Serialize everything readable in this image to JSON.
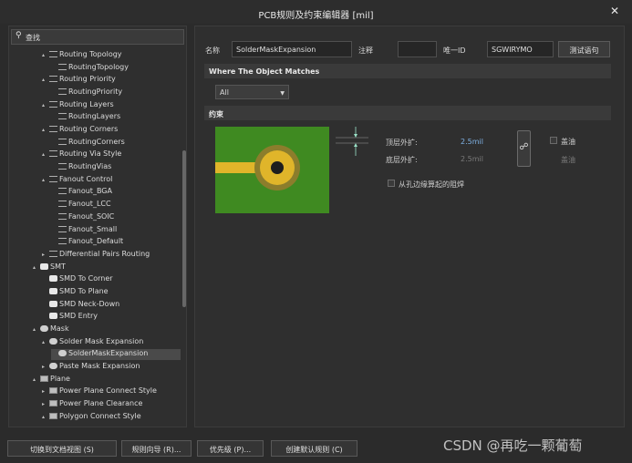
{
  "window": {
    "title": "PCB规则及约束编辑器 [mil]",
    "close_glyph": "✕"
  },
  "search": {
    "icon": "search-icon",
    "label": "查找"
  },
  "tree": [
    {
      "label": "Routing Topology",
      "indent": 3,
      "arrow": "▴",
      "icon": "route",
      "selected": false
    },
    {
      "label": "RoutingTopology",
      "indent": 4,
      "arrow": "",
      "icon": "route",
      "selected": false
    },
    {
      "label": "Routing Priority",
      "indent": 3,
      "arrow": "▴",
      "icon": "route",
      "selected": false
    },
    {
      "label": "RoutingPriority",
      "indent": 4,
      "arrow": "",
      "icon": "route",
      "selected": false
    },
    {
      "label": "Routing Layers",
      "indent": 3,
      "arrow": "▴",
      "icon": "route",
      "selected": false
    },
    {
      "label": "RoutingLayers",
      "indent": 4,
      "arrow": "",
      "icon": "route",
      "selected": false
    },
    {
      "label": "Routing Corners",
      "indent": 3,
      "arrow": "▴",
      "icon": "route",
      "selected": false
    },
    {
      "label": "RoutingCorners",
      "indent": 4,
      "arrow": "",
      "icon": "route",
      "selected": false
    },
    {
      "label": "Routing Via Style",
      "indent": 3,
      "arrow": "▴",
      "icon": "route",
      "selected": false
    },
    {
      "label": "RoutingVias",
      "indent": 4,
      "arrow": "",
      "icon": "route",
      "selected": false
    },
    {
      "label": "Fanout Control",
      "indent": 3,
      "arrow": "▴",
      "icon": "route",
      "selected": false
    },
    {
      "label": "Fanout_BGA",
      "indent": 4,
      "arrow": "",
      "icon": "route",
      "selected": false
    },
    {
      "label": "Fanout_LCC",
      "indent": 4,
      "arrow": "",
      "icon": "route",
      "selected": false
    },
    {
      "label": "Fanout_SOIC",
      "indent": 4,
      "arrow": "",
      "icon": "route",
      "selected": false
    },
    {
      "label": "Fanout_Small",
      "indent": 4,
      "arrow": "",
      "icon": "route",
      "selected": false
    },
    {
      "label": "Fanout_Default",
      "indent": 4,
      "arrow": "",
      "icon": "route",
      "selected": false
    },
    {
      "label": "Differential Pairs Routing",
      "indent": 3,
      "arrow": "▸",
      "icon": "route",
      "selected": false
    },
    {
      "label": "SMT",
      "indent": 2,
      "arrow": "▴",
      "icon": "smt",
      "selected": false
    },
    {
      "label": "SMD To Corner",
      "indent": 3,
      "arrow": "",
      "icon": "smt",
      "selected": false
    },
    {
      "label": "SMD To Plane",
      "indent": 3,
      "arrow": "",
      "icon": "smt",
      "selected": false
    },
    {
      "label": "SMD Neck-Down",
      "indent": 3,
      "arrow": "",
      "icon": "smt",
      "selected": false
    },
    {
      "label": "SMD Entry",
      "indent": 3,
      "arrow": "",
      "icon": "smt",
      "selected": false
    },
    {
      "label": "Mask",
      "indent": 2,
      "arrow": "▴",
      "icon": "mask",
      "selected": false
    },
    {
      "label": "Solder Mask Expansion",
      "indent": 3,
      "arrow": "▴",
      "icon": "mask",
      "selected": false
    },
    {
      "label": "SolderMaskExpansion",
      "indent": 4,
      "arrow": "",
      "icon": "mask",
      "selected": true
    },
    {
      "label": "Paste Mask Expansion",
      "indent": 3,
      "arrow": "▸",
      "icon": "mask",
      "selected": false
    },
    {
      "label": "Plane",
      "indent": 2,
      "arrow": "▴",
      "icon": "plane",
      "selected": false
    },
    {
      "label": "Power Plane Connect Style",
      "indent": 3,
      "arrow": "▸",
      "icon": "plane",
      "selected": false
    },
    {
      "label": "Power Plane Clearance",
      "indent": 3,
      "arrow": "▸",
      "icon": "plane",
      "selected": false
    },
    {
      "label": "Polygon Connect Style",
      "indent": 3,
      "arrow": "▴",
      "icon": "plane",
      "selected": false
    }
  ],
  "rule": {
    "name_label": "名称",
    "name_value": "SolderMaskExpansion",
    "comment_label": "注释",
    "comment_value": "",
    "uid_label": "唯一ID",
    "uid_value": "SGWIRYMO",
    "test_button": "测试语句"
  },
  "where_section": {
    "title": "Where The Object Matches",
    "scope_value": "All"
  },
  "constraint_section": {
    "title": "约束",
    "top_label": "顶层外扩:",
    "top_value": "2.5mil",
    "bottom_label": "底层外扩:",
    "bottom_value": "2.5mil",
    "tent_label": "盖油",
    "tent_label_bottom": "盖油",
    "from_hole_label": "从孔边缘算起的阻焊",
    "lock_icon": "link-icon"
  },
  "bottom_buttons": {
    "switch_view": "切换到文档视图 (S)",
    "rule_wizard": "规则向导 (R)...",
    "priority": "优先级 (P)...",
    "create_default": "创建默认规则 (C)"
  },
  "watermark": "CSDN @再吃一颗葡萄",
  "colors": {
    "board_green": "#3f8a21",
    "pad_yellow": "#e0b52a",
    "mask_ring": "#8c7d2c",
    "value_blue": "#7fb2e5"
  }
}
